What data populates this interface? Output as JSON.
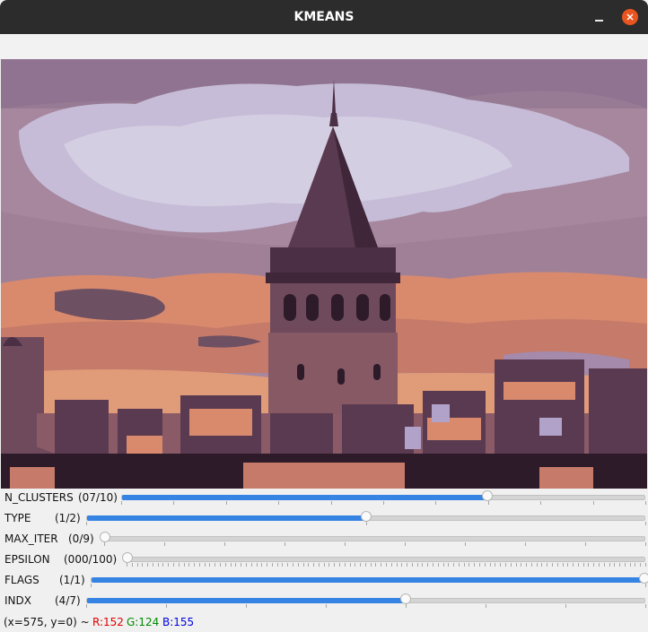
{
  "window": {
    "title": "KMEANS",
    "accent": "#3584e4",
    "close_color": "#e95420"
  },
  "image": {
    "icon": "kmeans-quantized-image"
  },
  "trackbars": [
    {
      "label": "N_CLUSTERS",
      "value": "(07/10)",
      "fraction": 0.7,
      "ticks": 10
    },
    {
      "label": "TYPE",
      "value": "(1/2)",
      "fraction": 0.5,
      "ticks": 2
    },
    {
      "label": "MAX_ITER",
      "value": "(0/9)",
      "fraction": 0.0,
      "ticks": 9
    },
    {
      "label": "EPSILON",
      "value": "(000/100)",
      "fraction": 0.0,
      "ticks": 100
    },
    {
      "label": "FLAGS",
      "value": "(1/1)",
      "fraction": 1.0,
      "ticks": 1
    },
    {
      "label": "INDX",
      "value": "(4/7)",
      "fraction": 0.571,
      "ticks": 7
    }
  ],
  "status": {
    "coords": "(x=575, y=0) ~",
    "r": "R:152",
    "g": "G:124",
    "b": "B:155",
    "r_color": "#e00000",
    "g_color": "#008a00",
    "b_color": "#0000e0"
  }
}
